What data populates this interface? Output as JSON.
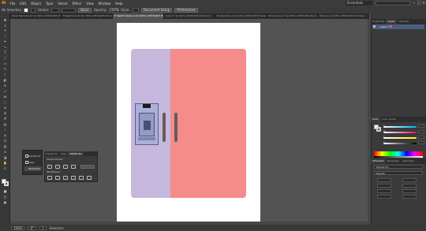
{
  "menubar": {
    "logo": "Ai",
    "items": [
      "File",
      "Edit",
      "Object",
      "Type",
      "Select",
      "Effect",
      "View",
      "Window",
      "Help"
    ],
    "workspace": "Essentials",
    "search_placeholder": ""
  },
  "controlbar": {
    "selection_label": "No Selection",
    "stroke_label": "Stroke:",
    "uniform": "Basic",
    "opacity_label": "Opacity:",
    "opacity_value": "100%",
    "style_label": "Style:",
    "document_setup": "Document Setup",
    "preferences": "Preferences"
  },
  "tabs": [
    {
      "label": "Kiosk Machine.ai* @ 100% (CMYK/GPU Preview)",
      "active": false
    },
    {
      "label": "FridgeFront.ai* @ 100% (CMYK/GPU Preview)",
      "active": false
    },
    {
      "label": "FridgeFrontside.ai @ 100% (CMYK/GPU Preview)",
      "active": true
    },
    {
      "label": "Sink.ai* @ 100% (CMYK/GPU Preview)",
      "active": false
    },
    {
      "label": "Dishwasher.ai @ 100% (CMYK/GPU Preview)",
      "active": false
    },
    {
      "label": "Microwave.ai* @ 100% (CMYK/GPU Preview)",
      "active": false
    },
    {
      "label": "Stove.ai @ 100% (CMYK/GPU Preview)",
      "active": false
    }
  ],
  "colors": {
    "door_left": "#c5b8dc",
    "door_right": "#f58b8b",
    "handle": "#6a5a5a"
  },
  "floating_tools": {
    "items": [
      "Transform",
      "Align",
      "Pathfinder"
    ]
  },
  "pathfinder": {
    "tabs": [
      "Transform",
      "Align",
      "Pathfinder"
    ],
    "shape_modes_label": "Shape Modes:",
    "pathfinders_label": "Pathfinders:",
    "expand_label": "Expand"
  },
  "right_panel": {
    "top_tabs": [
      "Properties",
      "Layers",
      "Libraries"
    ],
    "layer_name": "Layer 1",
    "color_tabs": [
      "Color",
      "Color Guide"
    ],
    "slider_labels": [
      "C",
      "M",
      "Y",
      "K"
    ],
    "char_tabs": [
      "Character",
      "Paragraph",
      "OpenType"
    ],
    "font_family": "Myriad Pro",
    "font_style": "Regular"
  },
  "statusbar": {
    "zoom": "100%",
    "rotation": "0°",
    "artboard_num": "1",
    "mode": "Selection"
  }
}
